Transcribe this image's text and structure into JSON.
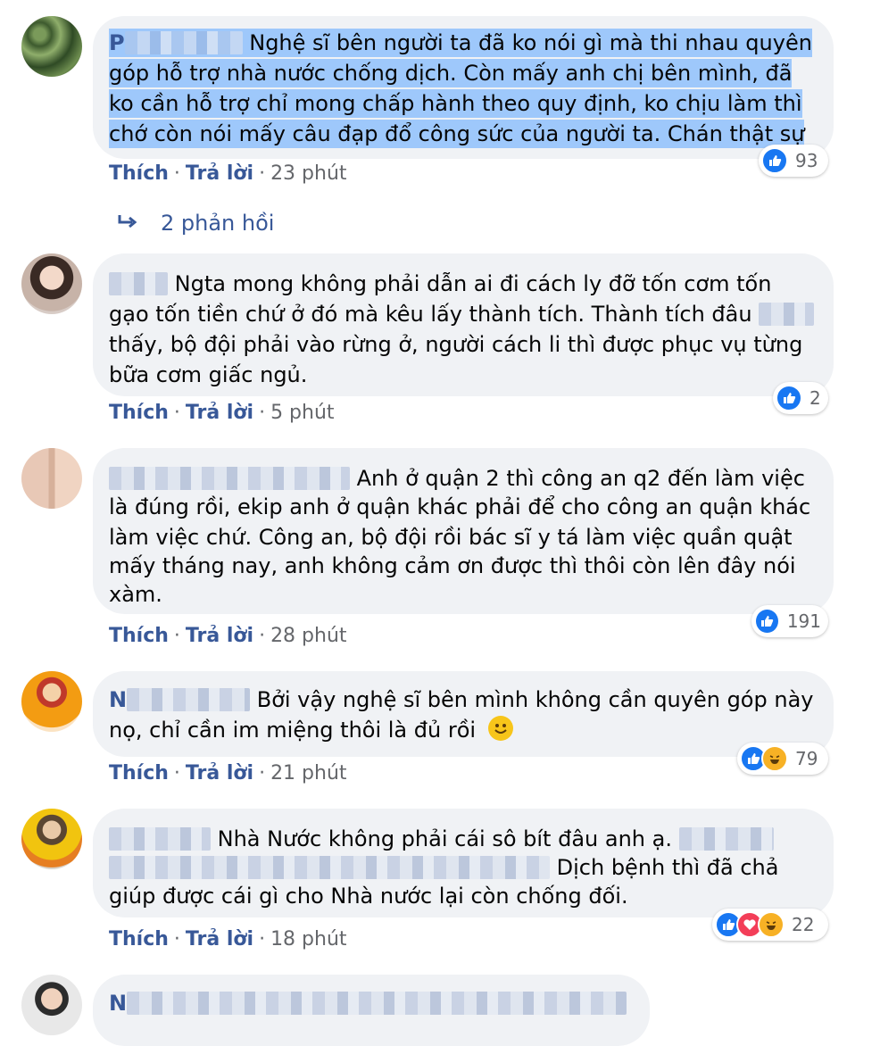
{
  "comments": [
    {
      "lines": [
        "Nghệ sĩ bên người ta đã ko nói gì mà thi nhau quyên",
        "góp hỗ trợ nhà nước chống dịch. Còn mấy anh chị bên mình, đã",
        "ko cần hỗ trợ chỉ mong chấp hành theo quy định, ko chịu làm thì",
        "chớ còn nói mấy câu đạp đổ công sức của người ta. Chán thật sự"
      ],
      "like": "Thích",
      "reply": "Trả lời",
      "time": "23 phút",
      "reaction_count": "93"
    },
    {
      "lines": [
        "Ngta mong không phải dẫn ai đi cách ly đỡ tốn cơm tốn",
        "gạo tốn tiền chứ ở đó mà kêu lấy thành tích. Thành tích đâu",
        "thấy, bộ đội phải vào rừng ở, người cách li thì được phục vụ từng",
        "bữa cơm giấc ngủ."
      ],
      "like": "Thích",
      "reply": "Trả lời",
      "time": "5 phút",
      "reaction_count": "2"
    },
    {
      "lines": [
        "Anh ở quận 2 thì công an q2 đến làm việc",
        "là đúng rồi, ekip anh ở quận khác phải để cho công an quận khác",
        "làm việc chứ. Công an, bộ đội rồi bác sĩ y tá làm việc quần quật",
        "mấy tháng nay, anh không cảm ơn được thì thôi còn lên đây nói",
        "xàm."
      ],
      "like": "Thích",
      "reply": "Trả lời",
      "time": "28 phút",
      "reaction_count": "191"
    },
    {
      "lines": [
        "Bởi vậy nghệ sĩ bên mình không cần quyên góp này",
        "nọ, chỉ cần im miệng thôi là đủ rồi"
      ],
      "like": "Thích",
      "reply": "Trả lời",
      "time": "21 phút",
      "reaction_count": "79"
    },
    {
      "lines": [
        "Nhà Nước không phải cái sô bít đâu anh ạ.",
        "Dịch bệnh thì đã chả",
        "giúp được cái gì cho Nhà nước lại còn chống đối."
      ],
      "like": "Thích",
      "reply": "Trả lời",
      "time": "18 phút",
      "reaction_count": "22"
    }
  ],
  "replies_label": "2 phản hồi",
  "name_initials": {
    "c1": "P",
    "c4": "N",
    "c6": "N"
  }
}
